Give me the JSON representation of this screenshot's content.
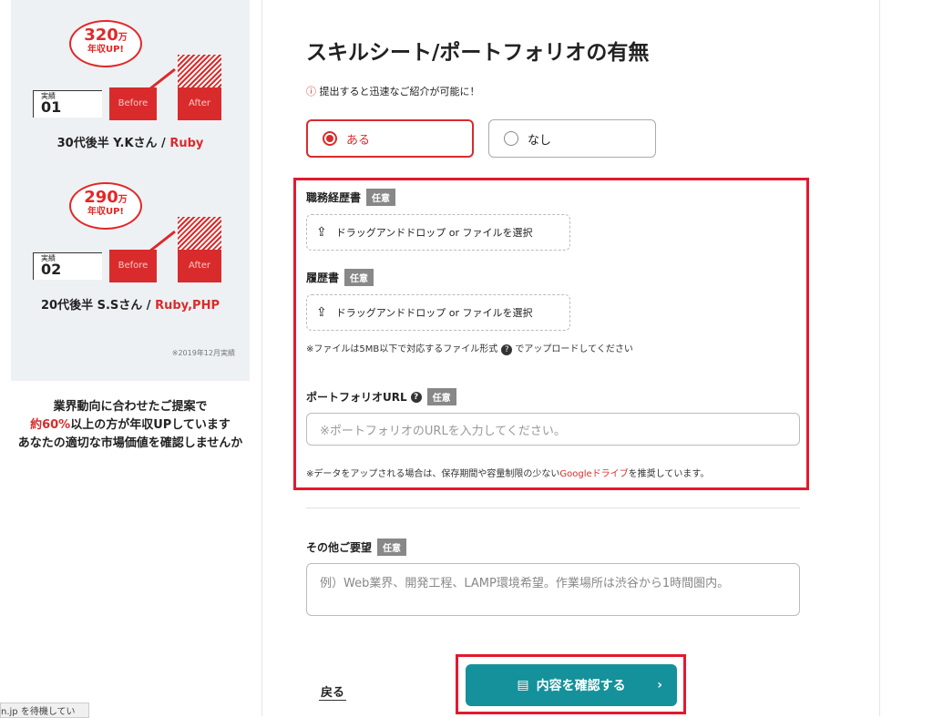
{
  "left": {
    "case1": {
      "amount": "320",
      "unit": "万",
      "up": "年収UP!",
      "jisseki": "実績",
      "num": "01",
      "before": "Before",
      "after": "After",
      "person": "30代後半 Y.Kさん / ",
      "lang": "Ruby"
    },
    "case2": {
      "amount": "290",
      "unit": "万",
      "up": "年収UP!",
      "jisseki": "実績",
      "num": "02",
      "before": "Before",
      "after": "After",
      "person": "20代後半 S.Sさん / ",
      "lang": "Ruby,PHP"
    },
    "note": "※2019年12月実績",
    "msg_line1": "業界動向に合わせたご提案で",
    "msg_red": "約60%",
    "msg_line2_rest": "以上の方が年収UPしています",
    "msg_line3": "あなたの適切な市場価値を確認しませんか"
  },
  "status_tooltip": "n.jp を待機してい",
  "form": {
    "title": "スキルシート/ポートフォリオの有無",
    "hint_icon": "ⓘ",
    "hint": "提出すると迅速なご紹介が可能に！",
    "radio_yes": "ある",
    "radio_no": "なし",
    "resume_label": "職務経歴書",
    "optional": "任意",
    "drop_text": "ドラッグアンドドロップ or ファイルを選択",
    "cv_label": "履歴書",
    "file_note_a": "※ファイルは5MB以下で対応するファイル形式",
    "file_note_b": "でアップロードしてください",
    "portfolio_label": "ポートフォリオURL",
    "portfolio_placeholder": "※ポートフォリオのURLを入力してください。",
    "data_note_a": "※データをアップされる場合は、保存期間や容量制限の少ない",
    "data_note_link": "Googleドライブ",
    "data_note_b": "を推奨しています。",
    "other_label": "その他ご要望",
    "other_placeholder": "例）Web業界、開発工程、LAMP環境希望。作業場所は渋谷から1時間圏内。",
    "back": "戻る",
    "confirm": "内容を確認する"
  }
}
